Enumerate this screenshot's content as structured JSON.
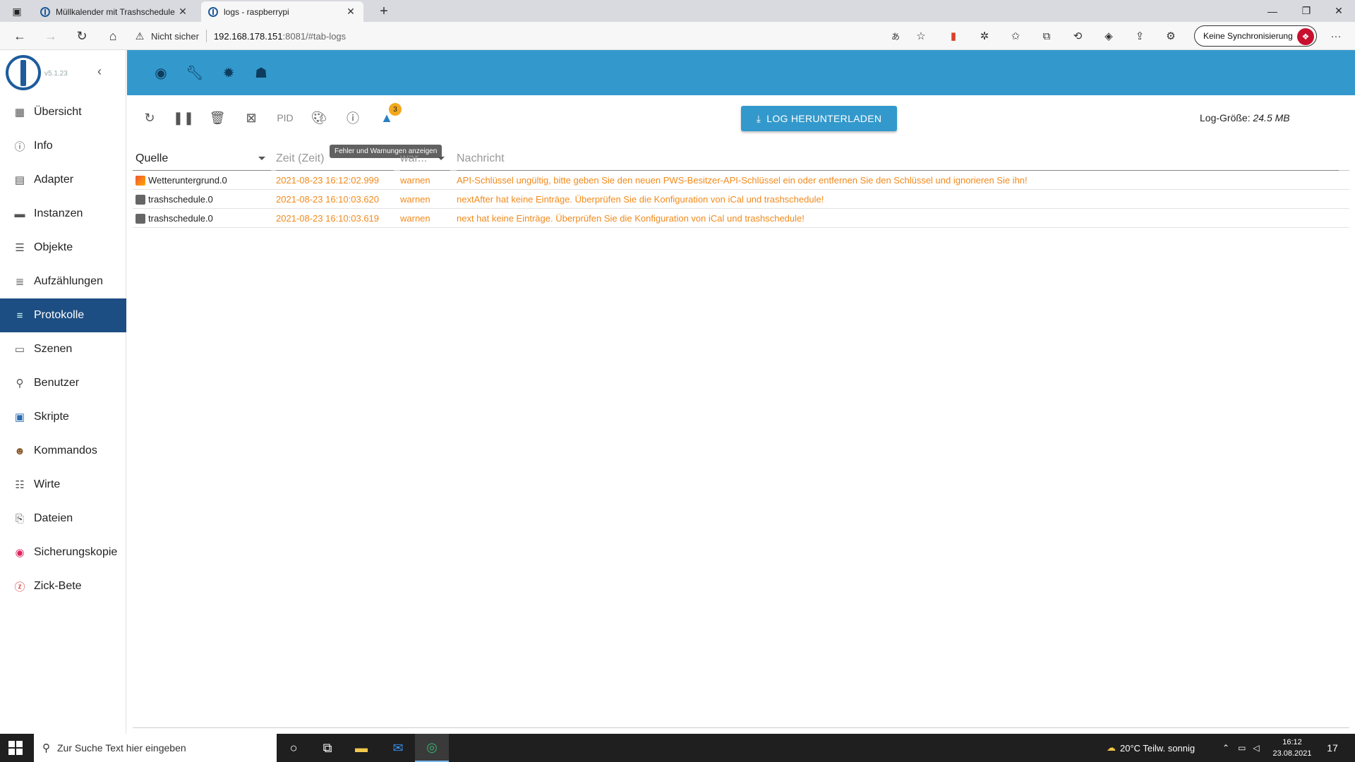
{
  "browser": {
    "tabs": [
      {
        "title": "Müllkalender mit Trashschedule",
        "close": "✕"
      },
      {
        "title": "logs - raspberrypi",
        "close": "✕"
      }
    ],
    "new_tab": "+",
    "window_controls": {
      "minimize": "—",
      "maximize": "❐",
      "close": "✕"
    },
    "security_label": "Nicht sicher",
    "url_host": "192.168.178.151",
    "url_rest": ":8081/#tab-logs",
    "sync_button": "Keine Synchronisierung",
    "more": "···"
  },
  "sidebar": {
    "version": "v5.1.23",
    "collapse": "‹",
    "items": [
      {
        "label": "Übersicht",
        "icon": "apps-icon"
      },
      {
        "label": "Info",
        "icon": "info-icon"
      },
      {
        "label": "Adapter",
        "icon": "store-icon"
      },
      {
        "label": "Instanzen",
        "icon": "instances-icon"
      },
      {
        "label": "Objekte",
        "icon": "list-icon"
      },
      {
        "label": "Aufzählungen",
        "icon": "enums-icon"
      },
      {
        "label": "Protokolle",
        "icon": "logs-icon",
        "active": true
      },
      {
        "label": "Szenen",
        "icon": "scenes-icon"
      },
      {
        "label": "Benutzer",
        "icon": "user-icon"
      },
      {
        "label": "Skripte",
        "icon": "javascript-icon"
      },
      {
        "label": "Kommandos",
        "icon": "commands-icon"
      },
      {
        "label": "Wirte",
        "icon": "hosts-icon"
      },
      {
        "label": "Dateien",
        "icon": "files-icon"
      },
      {
        "label": "Sicherungskopie",
        "icon": "backup-icon"
      },
      {
        "label": "Zick-Bete",
        "icon": "zigbee-icon"
      }
    ]
  },
  "toolbar": {
    "pid_label": "PID",
    "warnings_badge": "3",
    "tooltip": "Fehler und Warnungen anzeigen",
    "download_label": "LOG HERUNTERLADEN",
    "logsize_label": "Log-Größe:",
    "logsize_value": "24.5 MB"
  },
  "table": {
    "headers": {
      "source": "Quelle",
      "time": "Zeit (Zeit)",
      "severity": "war...",
      "message": "Nachricht"
    },
    "rows": [
      {
        "source": "Wetteruntergrund.0",
        "icon": "weather",
        "time": "2021-08-23 16:12:02.999",
        "severity": "warnen",
        "message": "API-Schlüssel ungültig, bitte geben Sie den neuen PWS-Besitzer-API-Schlüssel ein oder entfernen Sie den Schlüssel und ignorieren Sie ihn!"
      },
      {
        "source": "trashschedule.0",
        "icon": "trash",
        "time": "2021-08-23 16:10:03.620",
        "severity": "warnen",
        "message": "nextAfter hat keine Einträge. Überprüfen Sie die Konfiguration von iCal und trashschedule!"
      },
      {
        "source": "trashschedule.0",
        "icon": "trash",
        "time": "2021-08-23 16:10:03.619",
        "severity": "warnen",
        "message": "next hat keine Einträge. Überprüfen Sie die Konfiguration von iCal und trashschedule!"
      }
    ]
  },
  "taskbar": {
    "search_placeholder": "Zur Suche Text hier eingeben",
    "weather": "20°C  Teilw. sonnig",
    "time": "16:12",
    "date": "23.08.2021",
    "notifications": "17"
  },
  "colors": {
    "header_blue": "#3399cc",
    "sidebar_active": "#1d4e83",
    "warn_orange": "#f28a1c",
    "badge": "#f2a81d"
  }
}
